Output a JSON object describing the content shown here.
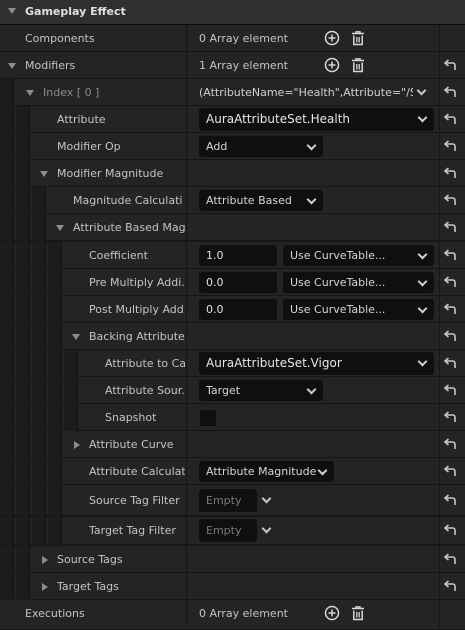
{
  "section": {
    "title": "Gameplay Effect"
  },
  "rows": {
    "components": {
      "label": "Components",
      "value": "0 Array element"
    },
    "modifiers": {
      "label": "Modifiers",
      "value": "1 Array element"
    },
    "index0": {
      "label": "Index [ 0 ]",
      "value": "(AttributeName=\"Health\",Attribute=\"/Sc"
    },
    "attribute": {
      "label": "Attribute",
      "value": "AuraAttributeSet.Health"
    },
    "modifier_op": {
      "label": "Modifier Op",
      "value": "Add"
    },
    "modifier_magnitude": {
      "label": "Modifier Magnitude"
    },
    "magnitude_calc": {
      "label": "Magnitude Calculati...",
      "value": "Attribute Based"
    },
    "attr_based_mag": {
      "label": "Attribute Based Mag..."
    },
    "coefficient": {
      "label": "Coefficient",
      "value": "1.0",
      "curve": "Use CurveTable..."
    },
    "pre_multiply": {
      "label": "Pre Multiply Addi...",
      "value": "0.0",
      "curve": "Use CurveTable..."
    },
    "post_multiply": {
      "label": "Post Multiply Add...",
      "value": "0.0",
      "curve": "Use CurveTable..."
    },
    "backing_attribute": {
      "label": "Backing Attribute"
    },
    "attribute_to_capture": {
      "label": "Attribute to Ca...",
      "value": "AuraAttributeSet.Vigor"
    },
    "attribute_source": {
      "label": "Attribute Sour...",
      "value": "Target"
    },
    "snapshot": {
      "label": "Snapshot"
    },
    "attribute_curve": {
      "label": "Attribute Curve"
    },
    "attribute_calculation": {
      "label": "Attribute Calculat...",
      "value": "Attribute Magnitude"
    },
    "source_tag_filter": {
      "label": "Source Tag Filter",
      "value": "Empty"
    },
    "target_tag_filter": {
      "label": "Target Tag Filter",
      "value": "Empty"
    },
    "source_tags": {
      "label": "Source Tags"
    },
    "target_tags": {
      "label": "Target Tags"
    },
    "executions": {
      "label": "Executions",
      "value": "0 Array element"
    }
  },
  "icons": {
    "add": "add-circle-icon",
    "delete": "trash-icon",
    "reset": "reset-to-default-arrow-icon",
    "expand": "triangle-down-icon",
    "collapse": "triangle-right-icon"
  },
  "colors": {
    "panel_bg": "#242424",
    "header_bg": "#2f2f2f",
    "field_bg": "#0f0f0f",
    "text": "#c4c4c4"
  }
}
